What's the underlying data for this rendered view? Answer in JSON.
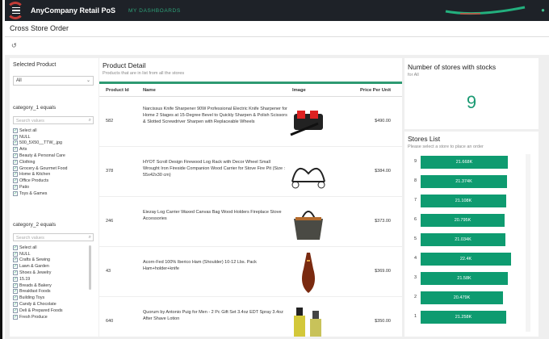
{
  "app": {
    "title": "AnyCompany Retail PoS",
    "nav_link": "MY DASHBOARDS"
  },
  "page": {
    "title": "Cross Store Order"
  },
  "colors": {
    "accent": "#0e9b70",
    "topbar": "#1e2228",
    "brand": "#e0413a"
  },
  "left_panel": {
    "selected_product_label": "Selected Product",
    "selected_product_value": "All",
    "category1_label": "category_1 equals",
    "category1_search_placeholder": "Search values",
    "category1_items": [
      "Select all",
      "NULL",
      "500_5X50__TTW_.jpg",
      "Arts",
      "Beauty & Personal Care",
      "Clothing",
      "Grocery & Gourmet Food",
      "Home & Kitchen",
      "Office Products",
      "Patio",
      "Toys & Games"
    ],
    "category2_label": "category_2 equals",
    "category2_search_placeholder": "Search values",
    "category2_items": [
      "Select all",
      "NULL",
      "Crafts & Sewing",
      "Lawn & Garden",
      "Shoes & Jewelry",
      "15.19",
      "Breads & Bakery",
      "Breakfast Foods",
      "Building Toys",
      "Candy & Chocolate",
      "Deli & Prepared Foods",
      "Fresh Produce"
    ]
  },
  "product_detail": {
    "title": "Product Detail",
    "subtitle": "Products that are in list from all the stores",
    "columns": {
      "id": "Product Id",
      "name": "Name",
      "image": "Image",
      "price": "Price Per Unit"
    },
    "rows": [
      {
        "id": "582",
        "name": "Narcissus Knife Sharpener 90W Professional Electric Knife Sharpener for Home 2 Stages at 15-Degree Bevel to Quickly Sharpen & Polish Scissors & Slotted Screwdriver Sharpen with Replaceable Wheels",
        "image": "knife-sharpener-image",
        "price": "$490.00"
      },
      {
        "id": "378",
        "name": "HYOT Scroll Design Firewood Log Rack with Decor Wheel Small Wrought Iron Fireside Companion Wood Carrier for Stove Fire Pit (Size : 55x42x30 cm)",
        "image": "log-rack-image",
        "price": "$384.00"
      },
      {
        "id": "246",
        "name": "Eiezay Log Carrier Waxed Canvas Bag Wood Holders Fireplace Stove Accessories",
        "image": "log-carrier-bag-image",
        "price": "$373.00"
      },
      {
        "id": "43",
        "name": "Acorn-Fed 100% Iberico Ham (Shoulder) 10-12 Lbs. Pack Ham+holder+knife",
        "image": "iberico-ham-image",
        "price": "$369.00"
      },
      {
        "id": "640",
        "name": "Quorum by Antonio Puig for Men - 2 Pc Gift Set 3.4oz EDT Spray 3.4oz After Shave Lotion",
        "image": "fragrance-set-image",
        "price": "$350.00"
      }
    ]
  },
  "stock_kpi": {
    "title": "Number of stores with stocks",
    "subtitle": "for All",
    "value": "9"
  },
  "stores_list": {
    "title": "Stores List",
    "subtitle": "Please select a store to place an order",
    "bars": [
      {
        "store": "9",
        "label": "21.668K",
        "value": 21668
      },
      {
        "store": "8",
        "label": "21.374K",
        "value": 21374
      },
      {
        "store": "7",
        "label": "21.108K",
        "value": 21108
      },
      {
        "store": "6",
        "label": "20.795K",
        "value": 20795
      },
      {
        "store": "5",
        "label": "21.034K",
        "value": 21034
      },
      {
        "store": "4",
        "label": "22.4K",
        "value": 22400
      },
      {
        "store": "3",
        "label": "21.58K",
        "value": 21580
      },
      {
        "store": "2",
        "label": "20.479K",
        "value": 20479
      },
      {
        "store": "1",
        "label": "21.258K",
        "value": 21258
      }
    ]
  }
}
